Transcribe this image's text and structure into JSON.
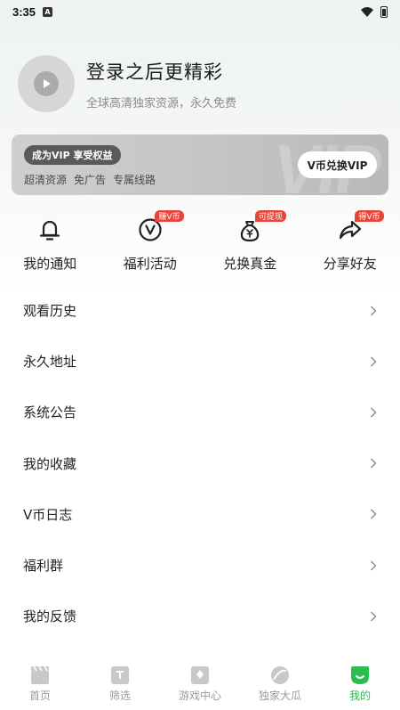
{
  "status_bar": {
    "time": "3:35",
    "notif_icon_letter": "A"
  },
  "profile": {
    "title": "登录之后更精彩",
    "subtitle": "全球高清独家资源，永久免费"
  },
  "vip_card": {
    "badge": "成为VIP 享受权益",
    "features": [
      "超清资源",
      "免广告",
      "专属线路"
    ],
    "button": "V币兑换VIP",
    "watermark": "VIP"
  },
  "quick_actions": [
    {
      "label": "我的通知",
      "icon": "bell-icon",
      "tag": ""
    },
    {
      "label": "福利活动",
      "icon": "v-coin-icon",
      "tag": "赚V币"
    },
    {
      "label": "兑换真金",
      "icon": "money-bag-icon",
      "tag": "可提现"
    },
    {
      "label": "分享好友",
      "icon": "share-icon",
      "tag": "得V币"
    }
  ],
  "menu": [
    {
      "label": "观看历史"
    },
    {
      "label": "永久地址"
    },
    {
      "label": "系统公告"
    },
    {
      "label": "我的收藏"
    },
    {
      "label": "V币日志"
    },
    {
      "label": "福利群"
    },
    {
      "label": "我的反馈"
    }
  ],
  "tabs": [
    {
      "label": "首页",
      "icon": "clapperboard-icon",
      "active": false
    },
    {
      "label": "筛选",
      "icon": "filter-icon",
      "active": false
    },
    {
      "label": "游戏中心",
      "icon": "game-card-icon",
      "active": false
    },
    {
      "label": "独家大瓜",
      "icon": "melon-icon",
      "active": false
    },
    {
      "label": "我的",
      "icon": "profile-icon",
      "active": true
    }
  ],
  "colors": {
    "accent_green": "#2dbd4e",
    "tag_red": "#e8443a"
  }
}
